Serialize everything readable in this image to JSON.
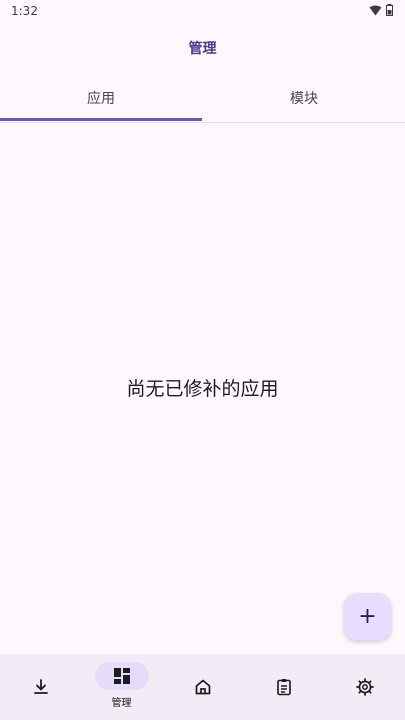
{
  "status_bar": {
    "time": "1:32",
    "icons": [
      "wifi-icon",
      "battery-icon"
    ]
  },
  "app_bar": {
    "title": "管理"
  },
  "tabs": [
    {
      "label": "应用",
      "selected": true
    },
    {
      "label": "模块",
      "selected": false
    }
  ],
  "empty_state": {
    "text": "尚无已修补的应用"
  },
  "fab": {
    "icon": "plus-icon",
    "label": "+"
  },
  "bottom_nav": {
    "items": [
      {
        "icon": "download-icon",
        "label": "",
        "selected": false
      },
      {
        "icon": "dashboard-icon",
        "label": "管理",
        "selected": true
      },
      {
        "icon": "home-icon",
        "label": "",
        "selected": false
      },
      {
        "icon": "clipboard-icon",
        "label": "",
        "selected": false
      },
      {
        "icon": "settings-icon",
        "label": "",
        "selected": false
      }
    ]
  },
  "colors": {
    "background": "#fdf8fd",
    "accent": "#6b57b0",
    "fab": "#e8ddff",
    "nav_bg": "#f1ecf5"
  }
}
